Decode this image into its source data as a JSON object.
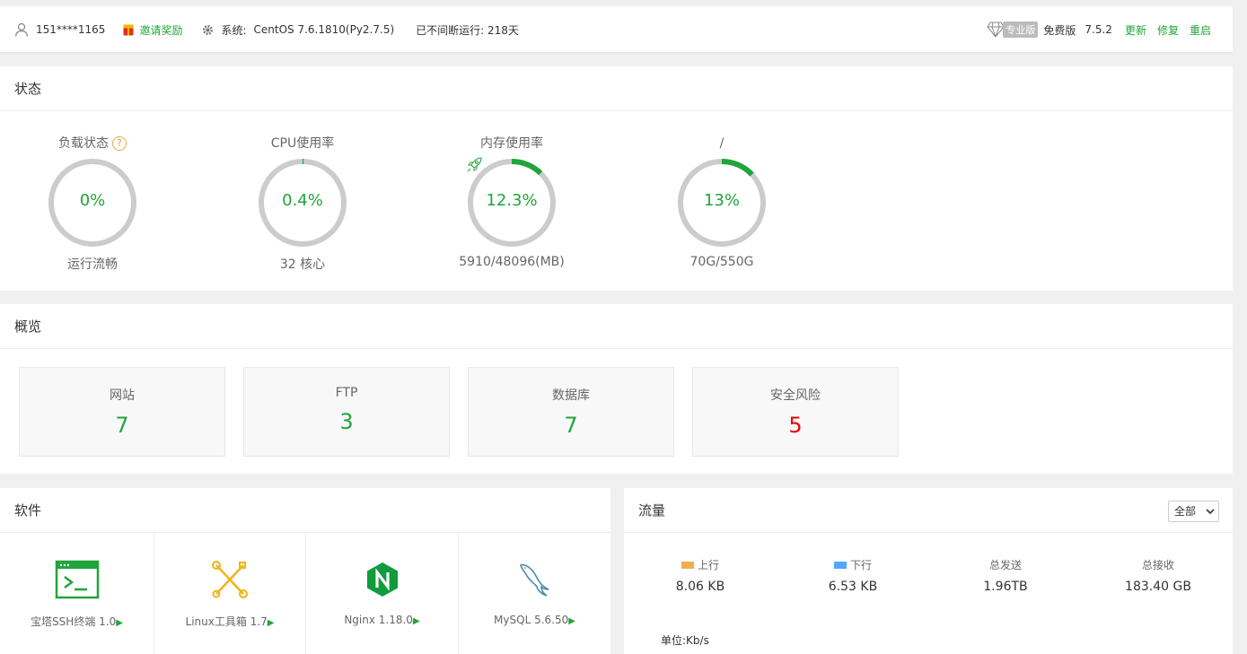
{
  "header": {
    "user": "151****1165",
    "invite": "邀请奖励",
    "system_label": "系统:",
    "system_value": "CentOS 7.6.1810(Py2.7.5)",
    "uptime": "已不间断运行: 218天",
    "pro_badge": "专业版",
    "edition": "免费版",
    "version": "7.5.2",
    "update": "更新",
    "repair": "修复",
    "restart": "重启"
  },
  "status": {
    "title": "状态",
    "gauges": [
      {
        "title": "负载状态",
        "value": "0%",
        "sub": "运行流畅",
        "percent": 0
      },
      {
        "title": "CPU使用率",
        "value": "0.4%",
        "sub": "32 核心",
        "percent": 0.4
      },
      {
        "title": "内存使用率",
        "value": "12.3%",
        "sub": "5910/48096(MB)",
        "percent": 12.3
      },
      {
        "title": "/",
        "value": "13%",
        "sub": "70G/550G",
        "percent": 13
      }
    ],
    "ring_color": "#20a53a",
    "track_color": "#cccccc"
  },
  "overview": {
    "title": "概览",
    "cards": [
      {
        "label": "网站",
        "value": "7"
      },
      {
        "label": "FTP",
        "value": "3"
      },
      {
        "label": "数据库",
        "value": "7"
      },
      {
        "label": "安全风险",
        "value": "5"
      }
    ]
  },
  "software": {
    "title": "软件",
    "items": [
      {
        "label": "宝塔SSH终端 1.0",
        "icon": "terminal-icon"
      },
      {
        "label": "Linux工具箱 1.7",
        "icon": "tools-icon"
      },
      {
        "label": "Nginx 1.18.0",
        "icon": "nginx-icon"
      },
      {
        "label": "MySQL 5.6.50",
        "icon": "mysql-icon"
      }
    ],
    "play": "▶"
  },
  "traffic": {
    "title": "流量",
    "select": "全部",
    "stats": [
      {
        "label": "上行",
        "value": "8.06 KB",
        "color": "#f0ad4e"
      },
      {
        "label": "下行",
        "value": "6.53 KB",
        "color": "#52a9ff"
      },
      {
        "label": "总发送",
        "value": "1.96TB"
      },
      {
        "label": "总接收",
        "value": "183.40 GB"
      }
    ],
    "unit": "单位:Kb/s"
  }
}
